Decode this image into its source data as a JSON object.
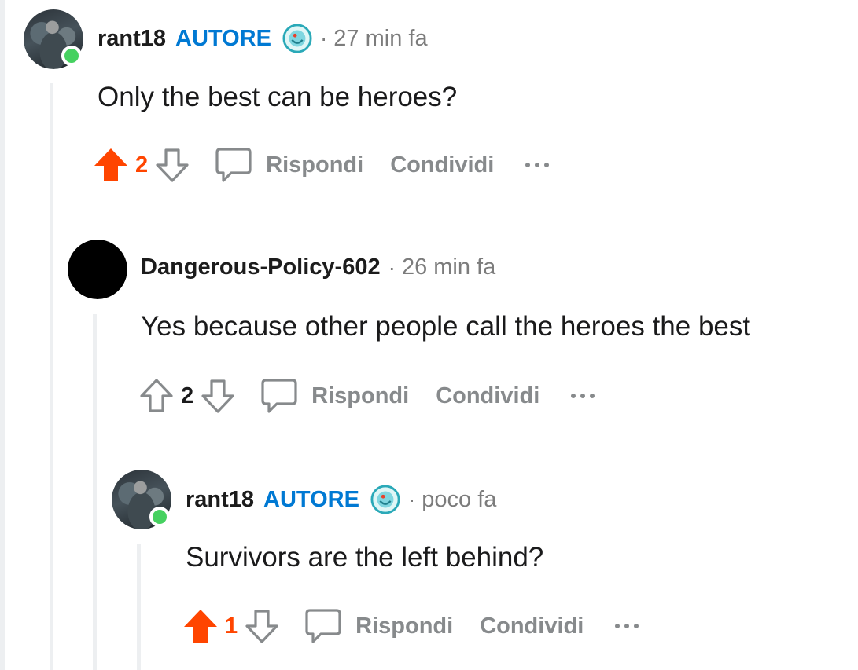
{
  "comments": [
    {
      "author": "rant18",
      "op_badge": "AUTORE",
      "separator": "·",
      "timestamp": "27 min fa",
      "body": "Only the best can be heroes?",
      "score": "2",
      "upvoted": true,
      "reply_label": "Rispondi",
      "share_label": "Condividi"
    },
    {
      "author": "Dangerous-Policy-602",
      "separator": "·",
      "timestamp": "26 min fa",
      "body": "Yes because other people call the heroes the best",
      "score": "2",
      "upvoted": false,
      "reply_label": "Rispondi",
      "share_label": "Condividi"
    },
    {
      "author": "rant18",
      "op_badge": "AUTORE",
      "separator": "·",
      "timestamp": "poco fa",
      "body": "Survivors are the left behind?",
      "score": "1",
      "upvoted": true,
      "reply_label": "Rispondi",
      "share_label": "Condividi"
    }
  ],
  "icons": {
    "upvote_active": "upvote-filled-icon",
    "upvote": "upvote-outline-icon",
    "downvote": "downvote-outline-icon",
    "reply": "comment-bubble-icon",
    "more": "more-dots-icon",
    "flair": "flair-emoji-icon"
  },
  "colors": {
    "upvote_active": "#ff4500",
    "op_badge": "#0079d3",
    "online": "#46d160",
    "meta_text": "#7c7c7c",
    "action_text": "#878a8c",
    "thread_line": "#edeff1"
  }
}
